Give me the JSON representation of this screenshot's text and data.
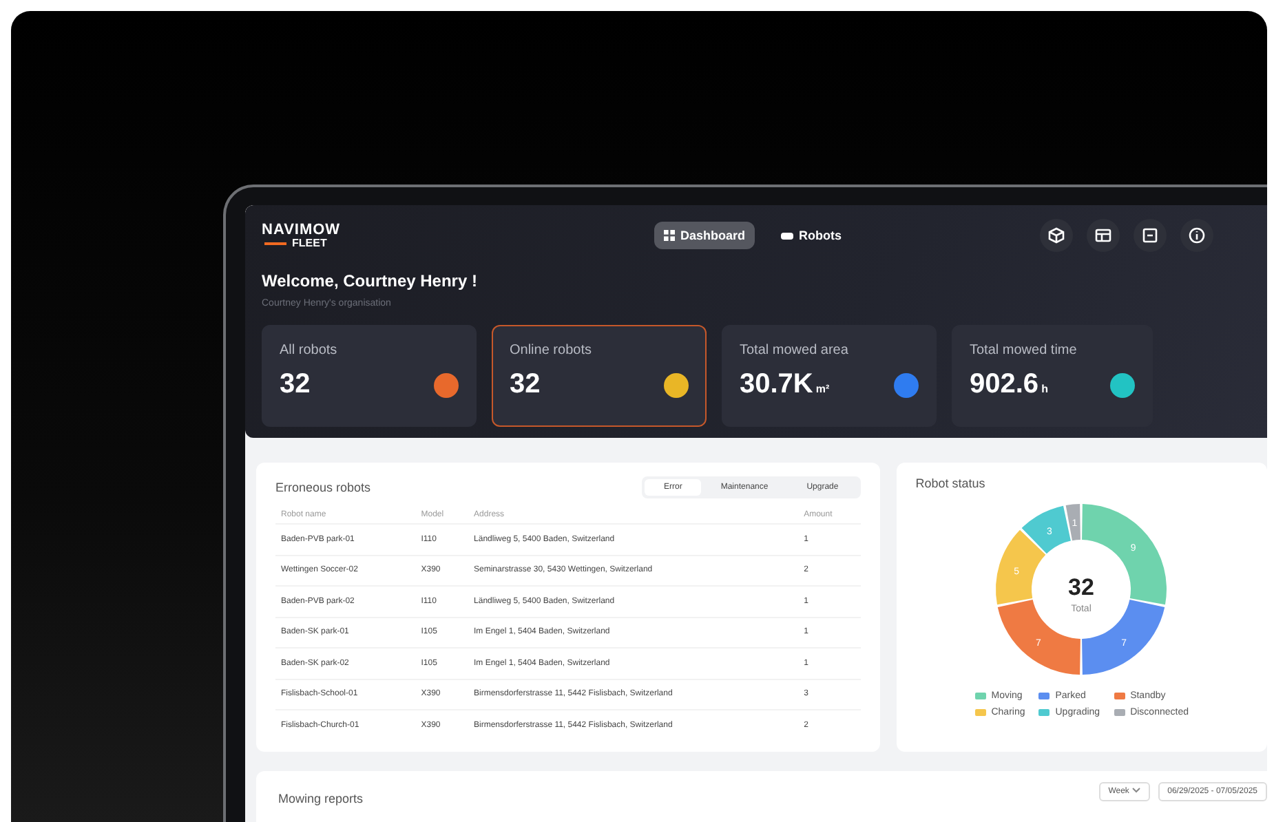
{
  "logo": {
    "brand": "NAVIMOW",
    "product": "FLEET"
  },
  "nav": [
    {
      "label": "Dashboard",
      "selected": true,
      "kind": "grid"
    },
    {
      "label": "Robots",
      "selected": false,
      "kind": "robot"
    }
  ],
  "header_icons": [
    {
      "kind": "cube"
    },
    {
      "kind": "window"
    },
    {
      "kind": "box"
    },
    {
      "kind": "info"
    }
  ],
  "welcome": {
    "title": "Welcome, Courtney Henry !",
    "subtitle": "Courtney Henry's organisation"
  },
  "stats": [
    {
      "label": "All robots",
      "value": "32",
      "selected": false,
      "color": "#e8692c"
    },
    {
      "label": "Online robots",
      "value": "32",
      "selected": true,
      "color": "#e9b626"
    },
    {
      "label": "Total mowed area",
      "value": "30.7K",
      "unit": "m²",
      "selected": false,
      "color": "#2f7cf0"
    },
    {
      "label": "Total mowed time",
      "value": "902.6",
      "unit": "h",
      "selected": false,
      "color": "#22c3c3"
    }
  ],
  "erroneous": {
    "title": "Erroneous robots",
    "filters": [
      {
        "label": "Error",
        "selected": true
      },
      {
        "label": "Maintenance",
        "selected": false
      },
      {
        "label": "Upgrade",
        "selected": false
      }
    ],
    "columns": [
      "Robot name",
      "Model",
      "Address",
      "Amount"
    ],
    "rows": [
      [
        "Baden-PVB park-01",
        "I110",
        "Ländliweg 5, 5400 Baden, Switzerland",
        "1"
      ],
      [
        "Wettingen Soccer-02",
        "X390",
        "Seminarstrasse 30, 5430 Wettingen, Switzerland",
        "2"
      ],
      [
        "Baden-PVB park-02",
        "I110",
        "Ländliweg 5, 5400 Baden, Switzerland",
        "1"
      ],
      [
        "Baden-SK park-01",
        "I105",
        "Im Engel 1, 5404 Baden, Switzerland",
        "1"
      ],
      [
        "Baden-SK park-02",
        "I105",
        "Im Engel 1, 5404 Baden, Switzerland",
        "1"
      ],
      [
        "Fislisbach-School-01",
        "X390",
        "Birmensdorferstrasse 11, 5442 Fislisbach, Switzerland",
        "3"
      ],
      [
        "Fislisbach-Church-01",
        "X390",
        "Birmensdorferstrasse 11, 5442 Fislisbach, Switzerland",
        "2"
      ]
    ]
  },
  "robot_status": {
    "title": "Robot status",
    "total": "32",
    "total_label": "Total",
    "chart_data": {
      "type": "donut",
      "categories": [
        "Moving",
        "Parked",
        "Standby",
        "Charing",
        "Upgrading",
        "Disconnected"
      ],
      "values": [
        9,
        7,
        7,
        5,
        3,
        1
      ],
      "colors": [
        "#6fd3ad",
        "#5b8ef0",
        "#ef7a43",
        "#f5c64c",
        "#4fcad0",
        "#a9adb3"
      ],
      "data_labels": true
    }
  },
  "mowing_reports": {
    "title": "Mowing reports",
    "period": "Week",
    "date_range": "06/29/2025 - 07/05/2025"
  }
}
